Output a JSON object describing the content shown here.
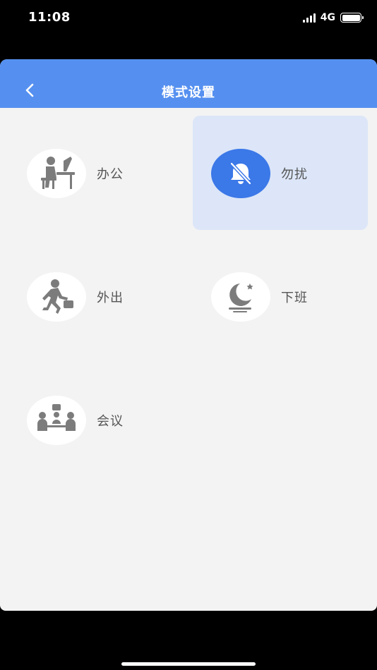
{
  "status_bar": {
    "time": "11:08",
    "network": "4G"
  },
  "header": {
    "title": "模式设置",
    "back_icon": "chevron-left-icon"
  },
  "modes": [
    {
      "label": "办公",
      "icon": "office-desk-icon",
      "selected": false
    },
    {
      "label": "勿扰",
      "icon": "bell-off-icon",
      "selected": true
    },
    {
      "label": "外出",
      "icon": "walking-briefcase-icon",
      "selected": false
    },
    {
      "label": "下班",
      "icon": "moon-icon",
      "selected": false
    },
    {
      "label": "会议",
      "icon": "meeting-icon",
      "selected": false
    }
  ],
  "colors": {
    "header": "#5590f0",
    "selected_tile": "#dce6f8",
    "selected_icon_bg": "#3b78e8",
    "icon_gray": "#7c7c7c"
  }
}
